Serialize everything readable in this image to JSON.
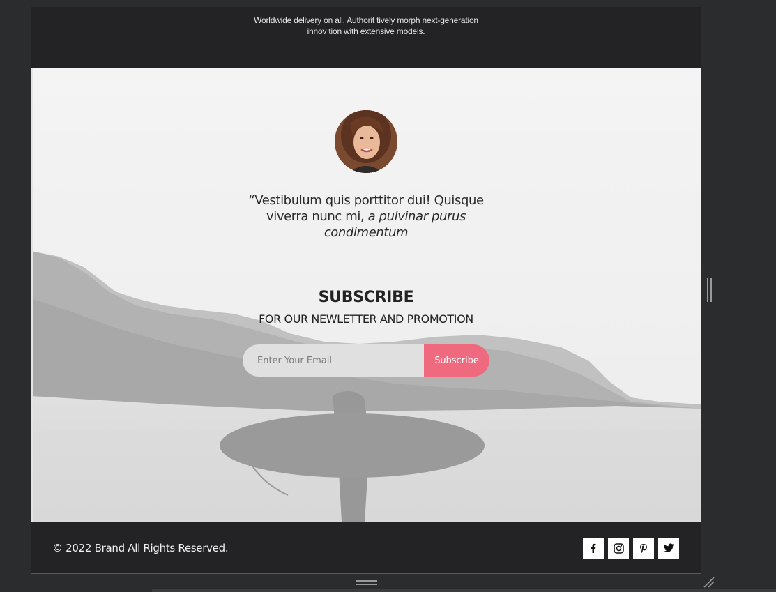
{
  "top_band": {
    "text": "Worldwide delivery on all. Authorit tively morph next-generation innov tion with extensive models."
  },
  "testimonial": {
    "quote_plain": "“Vestibulum quis porttitor dui! Quisque viverra nunc mi, ",
    "quote_italic": "a pulvinar purus condimentum"
  },
  "subscribe": {
    "title": "SUBSCRIBE",
    "caption": "FOR OUR NEWLETTER AND PROMOTION",
    "email_placeholder": "Enter Your Email",
    "button_label": "Subscribe",
    "button_color": "#f06a7f"
  },
  "footer": {
    "copyright": "© 2022 Brand All Rights Reserved.",
    "social_icons": [
      "facebook-icon",
      "instagram-icon",
      "pinterest-icon",
      "twitter-icon"
    ]
  },
  "colors": {
    "frame_bg": "#232325",
    "editor_bg": "#2b2c2e",
    "accent": "#f06a7f"
  }
}
